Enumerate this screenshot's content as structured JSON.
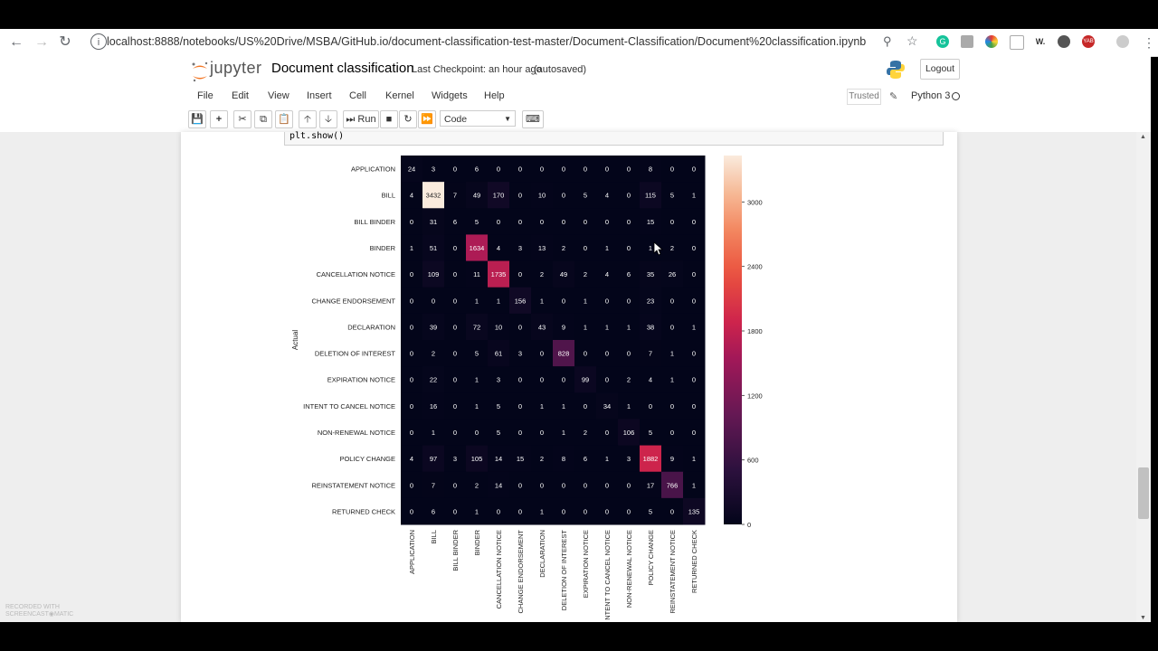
{
  "browser": {
    "url": "localhost:8888/notebooks/US%20Drive/MSBA/GitHub.io/document-classification-test-master/Document-Classification/Document%20classification.ipynb",
    "extensions": [
      "grammarly-icon",
      "ext-icon",
      "color-wheel-icon",
      "ext-icon",
      "w-icon",
      "ext-icon",
      "yab-icon",
      "profile-icon"
    ],
    "ext_labels": [
      "",
      "",
      "",
      "",
      "W.",
      "",
      "YAB",
      ""
    ]
  },
  "jupyter": {
    "logo_text": "jupyter",
    "notebook_title": "Document classification",
    "checkpoint": "Last Checkpoint: an hour ago",
    "autosave": "(autosaved)",
    "logout": "Logout",
    "menu": [
      "File",
      "Edit",
      "View",
      "Insert",
      "Cell",
      "Kernel",
      "Widgets",
      "Help"
    ],
    "trusted": "Trusted",
    "kernel": "Python 3",
    "run_label": "Run",
    "cell_type": "Code"
  },
  "cell": {
    "code": "plt.show()"
  },
  "chart_data": {
    "type": "heatmap",
    "ylabel": "Actual",
    "xlabel": "",
    "categories": [
      "APPLICATION",
      "BILL",
      "BILL BINDER",
      "BINDER",
      "CANCELLATION NOTICE",
      "CHANGE ENDORSEMENT",
      "DECLARATION",
      "DELETION OF INTEREST",
      "EXPIRATION NOTICE",
      "INTENT TO CANCEL NOTICE",
      "NON-RENEWAL NOTICE",
      "POLICY CHANGE",
      "REINSTATEMENT NOTICE",
      "RETURNED CHECK"
    ],
    "x_tick_labels": [
      "APPLICATION",
      "BILL",
      "BILL BINDER",
      "BINDER",
      "CANCELLATION NOTICE",
      "CHANGE ENDORSEMENT",
      "DECLARATION",
      "DELETION OF INTEREST",
      "EXPIRATION NOTICE",
      "NTENT TO CANCEL NOTICE",
      "NON-RENEWAL NOTICE",
      "POLICY CHANGE",
      "REINSTATEMENT NOTICE",
      "RETURNED CHECK"
    ],
    "matrix": [
      [
        24,
        3,
        0,
        6,
        0,
        0,
        0,
        0,
        0,
        0,
        0,
        8,
        0,
        0
      ],
      [
        4,
        3432,
        7,
        49,
        170,
        0,
        10,
        0,
        5,
        4,
        0,
        115,
        5,
        1
      ],
      [
        0,
        31,
        6,
        5,
        0,
        0,
        0,
        0,
        0,
        0,
        0,
        15,
        0,
        0
      ],
      [
        1,
        51,
        0,
        1634,
        4,
        3,
        13,
        2,
        0,
        1,
        0,
        1,
        2,
        0
      ],
      [
        0,
        109,
        0,
        11,
        1735,
        0,
        2,
        49,
        2,
        4,
        6,
        35,
        26,
        0
      ],
      [
        0,
        0,
        0,
        1,
        1,
        156,
        1,
        0,
        1,
        0,
        0,
        23,
        0,
        0
      ],
      [
        0,
        39,
        0,
        72,
        10,
        0,
        43,
        9,
        1,
        1,
        1,
        38,
        0,
        1
      ],
      [
        0,
        2,
        0,
        5,
        61,
        3,
        0,
        828,
        0,
        0,
        0,
        7,
        1,
        0
      ],
      [
        0,
        22,
        0,
        1,
        3,
        0,
        0,
        0,
        99,
        0,
        2,
        4,
        1,
        0
      ],
      [
        0,
        16,
        0,
        1,
        5,
        0,
        1,
        1,
        0,
        34,
        1,
        0,
        0,
        0
      ],
      [
        0,
        1,
        0,
        0,
        5,
        0,
        0,
        1,
        2,
        0,
        106,
        5,
        0,
        0
      ],
      [
        4,
        97,
        3,
        105,
        14,
        15,
        2,
        8,
        6,
        1,
        3,
        1882,
        9,
        1
      ],
      [
        0,
        7,
        0,
        2,
        14,
        0,
        0,
        0,
        0,
        0,
        0,
        17,
        766,
        1
      ],
      [
        0,
        6,
        0,
        1,
        0,
        0,
        1,
        0,
        0,
        0,
        0,
        5,
        0,
        135
      ]
    ],
    "colorbar": {
      "ticks": [
        0,
        600,
        1200,
        1800,
        2400,
        3000
      ],
      "range": [
        0,
        3432
      ],
      "colormap": "rocket"
    },
    "cursor_cell": [
      3,
      11
    ]
  }
}
